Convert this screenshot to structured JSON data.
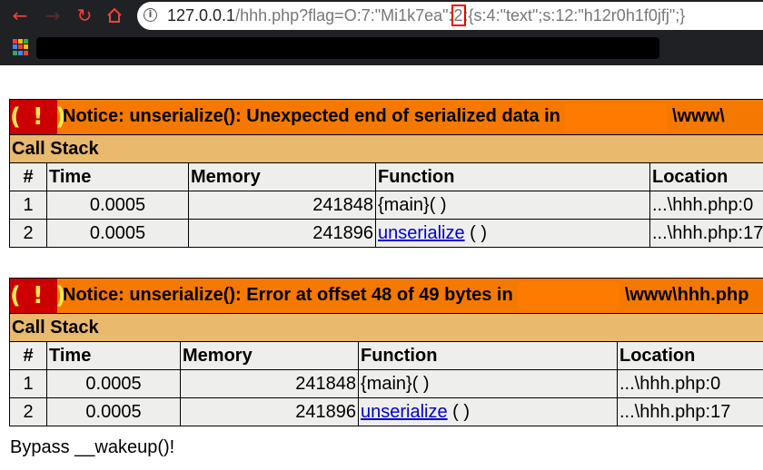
{
  "browser": {
    "url_host": "127.0.0.1",
    "url_path": "/hhh.php?flag=O:7:\"Mi1k7ea\":",
    "url_highlight": "2",
    "url_tail": ":{s:4:\"text\";s:12:\"h12r0h1f0jfj\";}",
    "accent_color": "#e8453c"
  },
  "notices": [
    {
      "icon": "( ! )",
      "message": "Notice: unserialize(): Unexpected end of serialized data in",
      "path_suffix": "\\www\\",
      "call_stack_label": "Call Stack",
      "columns": [
        "#",
        "Time",
        "Memory",
        "Function",
        "Location"
      ],
      "rows": [
        {
          "num": "1",
          "time": "0.0005",
          "memory": "241848",
          "func": "{main}( )",
          "func_link": false,
          "location": "...\\hhh.php:0"
        },
        {
          "num": "2",
          "time": "0.0005",
          "memory": "241896",
          "func": "unserialize",
          "func_suffix": " ( )",
          "func_link": true,
          "location": "...\\hhh.php:17"
        }
      ]
    },
    {
      "icon": "( ! )",
      "message": "Notice: unserialize(): Error at offset 48 of 49 bytes in",
      "path_suffix": "\\www\\hhh.php",
      "call_stack_label": "Call Stack",
      "columns": [
        "#",
        "Time",
        "Memory",
        "Function",
        "Location"
      ],
      "rows": [
        {
          "num": "1",
          "time": "0.0005",
          "memory": "241848",
          "func": "{main}( )",
          "func_link": false,
          "location": "...\\hhh.php:0"
        },
        {
          "num": "2",
          "time": "0.0005",
          "memory": "241896",
          "func": "unserialize",
          "func_suffix": " ( )",
          "func_link": true,
          "location": "...\\hhh.php:17"
        }
      ]
    }
  ],
  "output_text": "Bypass __wakeup()!"
}
